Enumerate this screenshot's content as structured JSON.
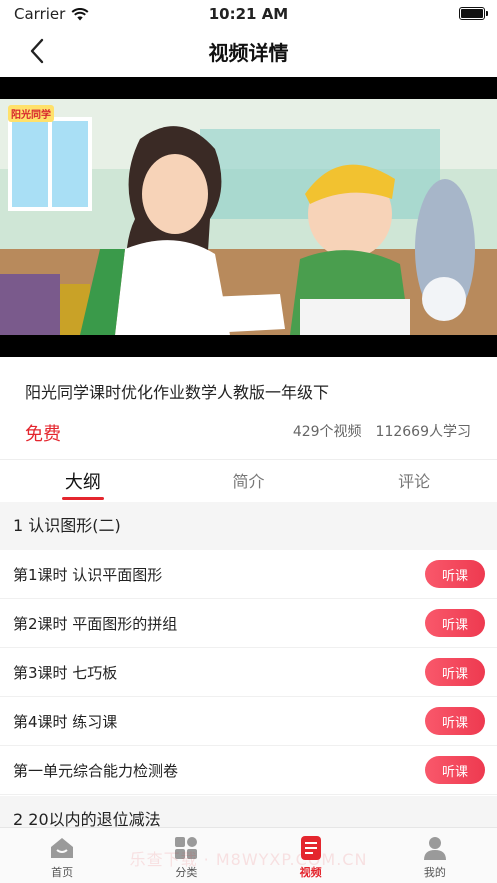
{
  "status_bar": {
    "carrier": "Carrier",
    "time": "10:21 AM"
  },
  "nav": {
    "title": "视频详情"
  },
  "video": {
    "brand": "阳光同学"
  },
  "course": {
    "title": "阳光同学课时优化作业数学人教版一年级下",
    "price": "免费",
    "video_count": "429个视频",
    "learner_count": "112669人学习"
  },
  "tabs": [
    {
      "label": "大纲",
      "active": true
    },
    {
      "label": "简介",
      "active": false
    },
    {
      "label": "评论",
      "active": false
    }
  ],
  "outline": {
    "chapter1": "1 认识图形(二)",
    "lessons": [
      {
        "title": "第1课时 认识平面图形",
        "action": "听课"
      },
      {
        "title": "第2课时 平面图形的拼组",
        "action": "听课"
      },
      {
        "title": "第3课时 七巧板",
        "action": "听课"
      },
      {
        "title": "第4课时 练习课",
        "action": "听课"
      },
      {
        "title": "第一单元综合能力检测卷",
        "action": "听课"
      }
    ],
    "chapter2": "2 20以内的退位减法"
  },
  "tab_bar": [
    {
      "label": "首页",
      "icon": "home-icon"
    },
    {
      "label": "分类",
      "icon": "category-icon"
    },
    {
      "label": "视频",
      "icon": "video-icon",
      "active": true
    },
    {
      "label": "我的",
      "icon": "user-icon"
    }
  ],
  "watermark": "乐查下载 · M8WYXP.COM.CN",
  "colors": {
    "accent": "#e4262e",
    "button": "#f04a5e"
  }
}
